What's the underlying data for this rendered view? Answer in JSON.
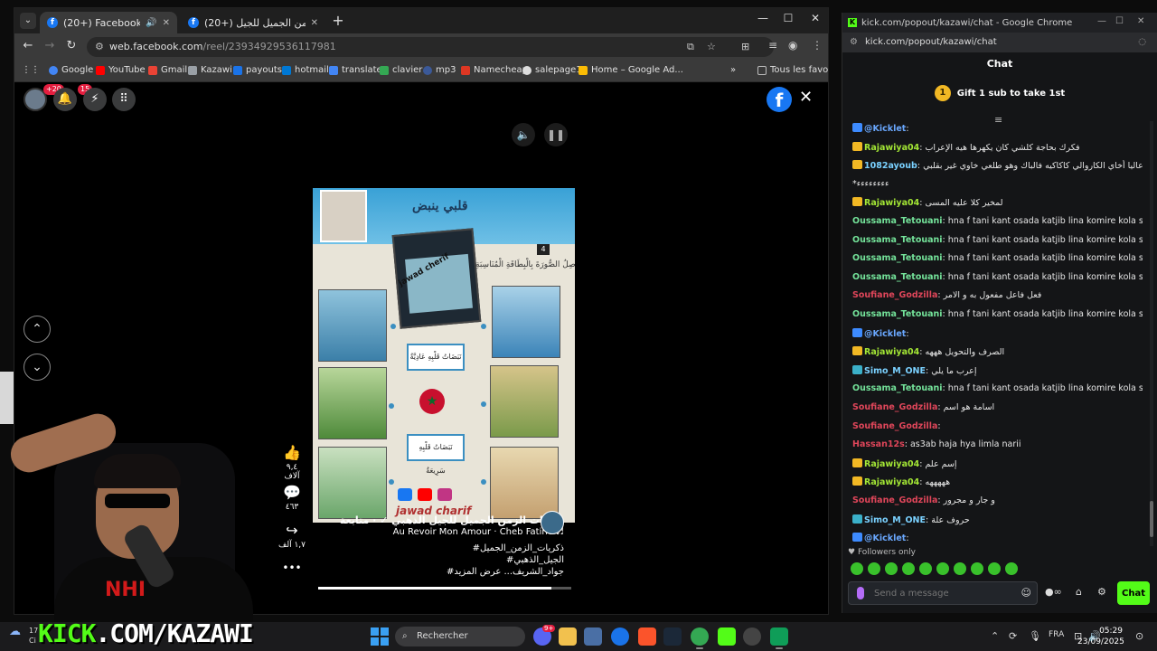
{
  "facebook_window": {
    "tabs": [
      {
        "label": "(20+) Facebook"
      },
      {
        "label": "(20+) ذكريات الزمن الجميل للجيل..."
      }
    ],
    "new_tab_icon": "plus-icon",
    "url_host": "web.facebook.com",
    "url_path": "/reel/23934929536117981",
    "bookmarks": [
      {
        "label": "Google",
        "color": "#4285f4"
      },
      {
        "label": "YouTube",
        "color": "#ff0000"
      },
      {
        "label": "Gmail",
        "color": "#ea4335"
      },
      {
        "label": "Kazawi",
        "color": "#9aa0a6"
      },
      {
        "label": "payouts",
        "color": "#1a73e8"
      },
      {
        "label": "hotmail",
        "color": "#0078d4"
      },
      {
        "label": "translate",
        "color": "#4285f4"
      },
      {
        "label": "clavier",
        "color": "#34a853"
      },
      {
        "label": "mp3",
        "color": "#3b5998"
      },
      {
        "label": "Namecheap",
        "color": "#de3723"
      },
      {
        "label": "salepage1",
        "color": "#dddddd"
      },
      {
        "label": "Home – Google Ad...",
        "color": "#fbbc04"
      }
    ],
    "bookmarks_more": "»",
    "all_bookmarks": "Tous les favoris",
    "notif_count": "+20",
    "messenger_count": "15",
    "reel": {
      "title": "قلبي ينبض",
      "page_number": "4",
      "instruction": "أَصِلُ الصُّورَةَ بِالْبِطَاقَةِ الْمُنَاسِبَةِ :",
      "box_top": "نَبَضَاتُ قَلْبِهِ عَادِيَّةٌ",
      "box_bottom": "نَبَضَاتُ قَلْبِهِ سَرِيعَةٌ",
      "watermark": "jawad cherif",
      "author_watermark": "jawad charif"
    },
    "actions": {
      "likes": "٩,٤ آلاف",
      "comments": "٤٦٣",
      "shares": "١,٧ آلف",
      "more": "•••"
    },
    "caption": {
      "page_line": "ذكريات الزمن الجميل للجيل الذهبي ✓ · متابعة",
      "music": "Au Revoir Mon Amour · Cheb Fatine ♬",
      "tag1": "#ذكريات_الزمن_الجميل",
      "tag2": "#الجيل_الذهبي",
      "tag3": "#جواد_الشريف... عرض المزيد"
    },
    "progress": 0.92
  },
  "chat_window": {
    "title": "kick.com/popout/kazawi/chat - Google Chrome",
    "url": "kick.com/popout/kazawi/chat",
    "header": "Chat",
    "gift_count": "1",
    "gift_text": "Gift 1 sub to take 1st",
    "messages": [
      {
        "user": "@Kicklet",
        "text": "",
        "color": "#6aa8ff",
        "badge": "#3d8bff"
      },
      {
        "user": "Rajawiya04",
        "text": "فكرك بحاجة كلشي كان يكهرها هيه الإعراب",
        "color": "#a3e635",
        "badge": "#f2b824"
      },
      {
        "user": "1082ayoub",
        "text": "دبا أعاليا أخاي الكاروالي كاكاكيه فالباك وهو طلعي خاوي غير بقلبي",
        "color": "#7ad1ff",
        "badge": "#f2b824"
      },
      {
        "user": "",
        "text": "*ءءءءءءءء",
        "color": "#e6e6e6",
        "badge": ""
      },
      {
        "user": "Rajawiya04",
        "text": "لمخير كلا عليه المسى",
        "color": "#a3e635",
        "badge": "#f2b824"
      },
      {
        "user": "Oussama_Tetouani",
        "text": "hna f tani kant osada katjib lina komire kola sbah",
        "color": "#74e39a",
        "badge": ""
      },
      {
        "user": "Oussama_Tetouani",
        "text": "hna f tani kant osada katjib lina komire kola sbah",
        "color": "#74e39a",
        "badge": ""
      },
      {
        "user": "Oussama_Tetouani",
        "text": "hna f tani kant osada katjib lina komire kola sbah",
        "color": "#74e39a",
        "badge": ""
      },
      {
        "user": "Oussama_Tetouani",
        "text": "hna f tani kant osada katjib lina komire kola sbah",
        "color": "#74e39a",
        "badge": ""
      },
      {
        "user": "Soufiane_Godzilla",
        "text": "فعل فاعل مفعول به و الامر",
        "color": "#e0465a",
        "badge": ""
      },
      {
        "user": "Oussama_Tetouani",
        "text": "hna f tani kant osada katjib lina komire kola sbah",
        "color": "#74e39a",
        "badge": ""
      },
      {
        "user": "@Kicklet",
        "text": "",
        "color": "#6aa8ff",
        "badge": "#3d8bff"
      },
      {
        "user": "Rajawiya04",
        "text": "الصرف والتحويل هههه",
        "color": "#a3e635",
        "badge": "#f2b824"
      },
      {
        "user": "Simo_M_ONE",
        "text": "إعرب ما يلي",
        "color": "#7ad1ff",
        "badge": "#3bb0c9"
      },
      {
        "user": "Oussama_Tetouani",
        "text": "hna f tani kant osada katjib lina komire kola sbah",
        "color": "#74e39a",
        "badge": ""
      },
      {
        "user": "Soufiane_Godzilla",
        "text": "اسامة هو اسم",
        "color": "#e0465a",
        "badge": ""
      },
      {
        "user": "Soufiane_Godzilla",
        "text": "",
        "color": "#e0465a",
        "badge": ""
      },
      {
        "user": "Hassan12s",
        "text": "as3ab haja hya limla narii",
        "color": "#e0465a",
        "badge": ""
      },
      {
        "user": "Rajawiya04",
        "text": "إسم علم",
        "color": "#a3e635",
        "badge": "#f2b824"
      },
      {
        "user": "Rajawiya04",
        "text": "هههههه",
        "color": "#a3e635",
        "badge": "#f2b824"
      },
      {
        "user": "Soufiane_Godzilla",
        "text": "و جار و مجرور",
        "color": "#e0465a",
        "badge": ""
      },
      {
        "user": "Simo_M_ONE",
        "text": "حروف علة",
        "color": "#7ad1ff",
        "badge": "#3bb0c9"
      },
      {
        "user": "@Kicklet",
        "text": "",
        "color": "#6aa8ff",
        "badge": "#3d8bff"
      }
    ],
    "followers_only": "Followers only",
    "input_placeholder": "Send a message",
    "chat_button": "Chat"
  },
  "overlay": {
    "banner_k": "KICK",
    "banner_rest": ".COM/KAZAWI",
    "shirt_logo": "NHI"
  },
  "taskbar": {
    "weather_temp": "17",
    "weather_code": "Ci",
    "search_placeholder": "Rechercher",
    "lang": "FRA",
    "time": "05:29",
    "date": "23/09/2025",
    "discord_badge": "9+"
  },
  "colors": {
    "kick_green": "#53fc18",
    "facebook_blue": "#1877f2"
  }
}
